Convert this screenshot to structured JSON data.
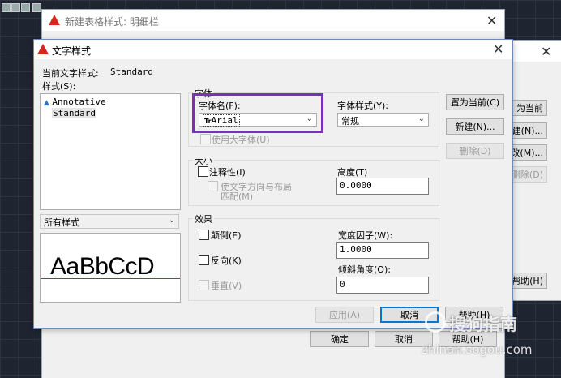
{
  "background_window": {
    "title": "新建表格样式: 明细栏",
    "ok_label": "确定",
    "cancel_label": "取消",
    "help_label": "帮助(H)"
  },
  "right_window": {
    "buttons": [
      "为当前",
      "建(N)...",
      "改(M)...",
      "删除(D)",
      "帮助(H)"
    ]
  },
  "dialog": {
    "title": "文字样式",
    "current_style_label": "当前文字样式:",
    "current_style_value": "Standard",
    "styles_label": "样式(S):",
    "styles": [
      "Annotative",
      "Standard"
    ],
    "filter_value": "所有样式",
    "preview_text": "AaBbCcD",
    "font_group": {
      "title": "字体",
      "font_name_label": "字体名(F):",
      "font_name_value": "Arial",
      "font_name_prefix": "Tr",
      "font_style_label": "字体样式(Y):",
      "font_style_value": "常规",
      "big_font_label": "使用大字体(U)"
    },
    "size_group": {
      "title": "大小",
      "annotative_label": "注释性(I)",
      "match_orientation_label_line1": "使文字方向与布局",
      "match_orientation_label_line2": "匹配(M)",
      "height_label": "高度(T)",
      "height_value": "0.0000"
    },
    "effects_group": {
      "title": "效果",
      "upside_down_label": "颠倒(E)",
      "backwards_label": "反向(K)",
      "vertical_label": "垂直(V)",
      "width_factor_label": "宽度因子(W):",
      "width_factor_value": "1.0000",
      "oblique_label": "倾斜角度(O):",
      "oblique_value": "0"
    },
    "set_current_label": "置为当前(C)",
    "new_label": "新建(N)...",
    "delete_label": "删除(D)",
    "apply_label": "应用(A)",
    "cancel_label": "取消",
    "help_label": "帮助(H)"
  },
  "watermark": {
    "text": "搜狗指南",
    "url": "zhinan.sogou.com"
  },
  "colors": {
    "highlight_box": "#7b2fbf",
    "accent": "#0078d7",
    "preview_baseline": "#d21e1e"
  }
}
